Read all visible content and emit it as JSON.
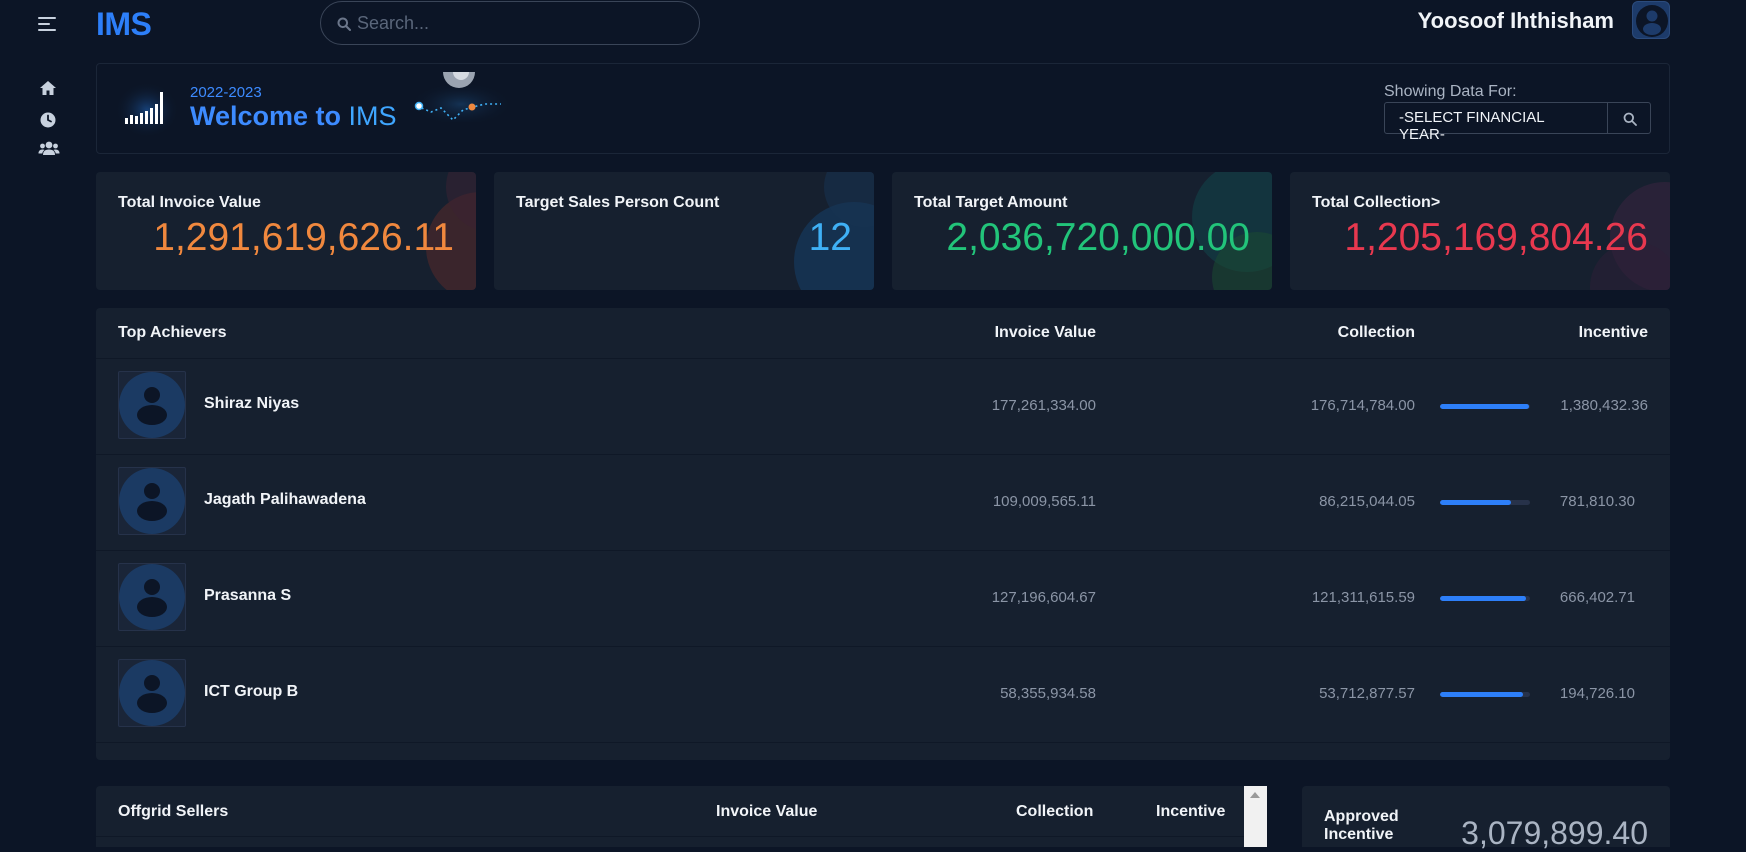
{
  "app": {
    "logo": "IMS"
  },
  "search": {
    "placeholder": "Search..."
  },
  "user": {
    "name": "Yoosoof Ihthisham"
  },
  "sidebar": {
    "icons": [
      "home-icon",
      "clock-icon",
      "users-icon"
    ]
  },
  "welcome": {
    "year": "2022-2023",
    "title_prefix": "Welcome to ",
    "title_brand": "IMS",
    "showing_label": "Showing Data For:",
    "fy_select": "-SELECT FINANCIAL YEAR-"
  },
  "cards": [
    {
      "title": "Total Invoice Value",
      "value": "1,291,619,626.11",
      "color": "#f0883e"
    },
    {
      "title": "Target Sales Person Count",
      "value": "12",
      "color": "#3fb0f5"
    },
    {
      "title": "Total Target Amount",
      "value": "2,036,720,000.00",
      "color": "#22c47a"
    },
    {
      "title": "Total Collection>",
      "value": "1,205,169,804.26",
      "color": "#e8384f"
    }
  ],
  "top_achievers": {
    "headers": {
      "name": "Top Achievers",
      "invoice": "Invoice Value",
      "collection": "Collection",
      "incentive": "Incentive"
    },
    "rows": [
      {
        "name": "Shiraz Niyas",
        "invoice": "177,261,334.00",
        "collection": "176,714,784.00",
        "progress": 0.99,
        "incentive": "1,380,432.36"
      },
      {
        "name": "Jagath Palihawadena",
        "invoice": "109,009,565.11",
        "collection": "86,215,044.05",
        "progress": 0.79,
        "incentive": "781,810.30"
      },
      {
        "name": "Prasanna S",
        "invoice": "127,196,604.67",
        "collection": "121,311,615.59",
        "progress": 0.95,
        "incentive": "666,402.71"
      },
      {
        "name": "ICT Group B",
        "invoice": "58,355,934.58",
        "collection": "53,712,877.57",
        "progress": 0.92,
        "incentive": "194,726.10"
      }
    ]
  },
  "offgrid": {
    "headers": {
      "name": "Offgrid Sellers",
      "invoice": "Invoice Value",
      "collection": "Collection",
      "incentive": "Incentive"
    }
  },
  "approved": {
    "label": "Approved Incentive",
    "value": "3,079,899.40"
  }
}
